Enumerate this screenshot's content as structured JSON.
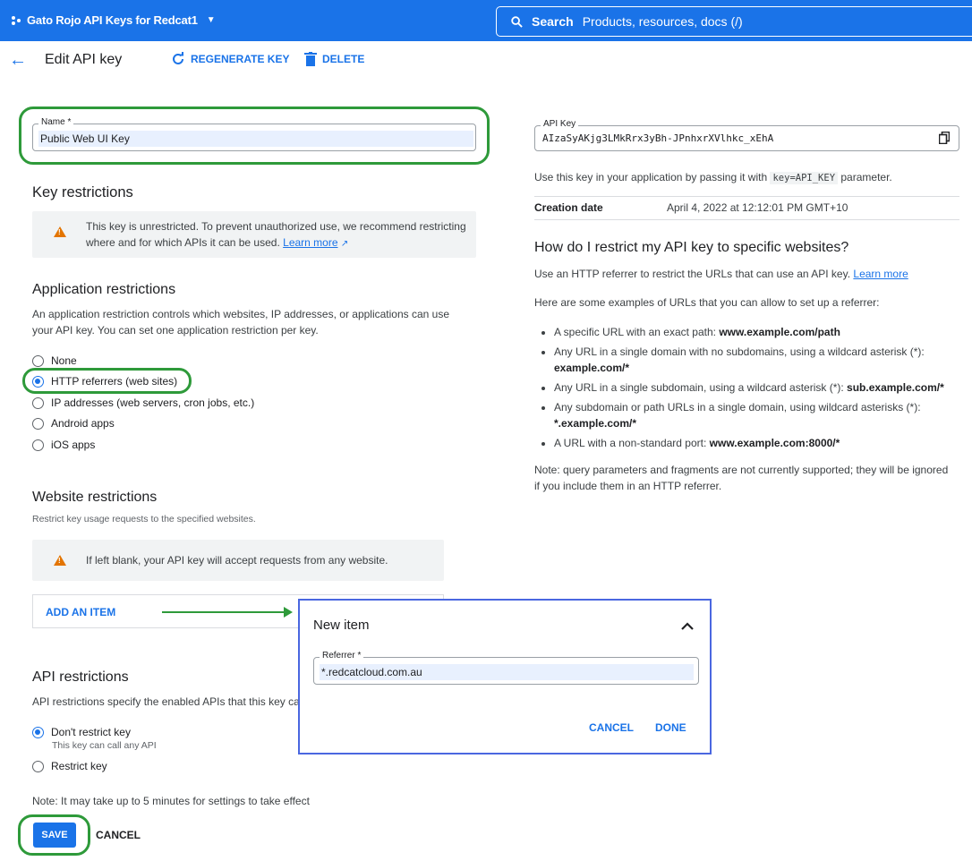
{
  "topbar": {
    "project_name": "Gato Rojo API Keys for Redcat1",
    "search_label": "Search",
    "search_placeholder": "Products, resources, docs (/)"
  },
  "actionbar": {
    "title": "Edit API key",
    "regenerate": "REGENERATE KEY",
    "delete": "DELETE"
  },
  "name_field": {
    "label": "Name *",
    "value": "Public Web UI Key"
  },
  "key_restrictions": {
    "heading": "Key restrictions",
    "warning": "This key is unrestricted. To prevent unauthorized use, we recommend restricting where and for which APIs it can be used.",
    "learn_more": "Learn more"
  },
  "app_restrictions": {
    "heading": "Application restrictions",
    "description": "An application restriction controls which websites, IP addresses, or applications can use your API key. You can set one application restriction per key.",
    "options": [
      "None",
      "HTTP referrers (web sites)",
      "IP addresses (web servers, cron jobs, etc.)",
      "Android apps",
      "iOS apps"
    ],
    "selected": "HTTP referrers (web sites)"
  },
  "website_restrictions": {
    "heading": "Website restrictions",
    "description": "Restrict key usage requests to the specified websites.",
    "warning": "If left blank, your API key will accept requests from any website.",
    "add_item": "ADD AN ITEM"
  },
  "new_item": {
    "title": "New item",
    "referrer_label": "Referrer *",
    "referrer_value": "*.redcatcloud.com.au",
    "cancel": "CANCEL",
    "done": "DONE"
  },
  "api_restrictions": {
    "heading": "API restrictions",
    "description": "API restrictions specify the enabled APIs that this key can",
    "option1": "Don't restrict key",
    "option1_sub": "This key can call any API",
    "option2": "Restrict key",
    "note": "Note: It may take up to 5 minutes for settings to take effect"
  },
  "footer": {
    "save": "SAVE",
    "cancel": "CANCEL"
  },
  "api_key": {
    "label": "API Key",
    "value": "AIzaSyAKjg3LMkRrx3yBh-JPnhxrXVlhkc_xEhA",
    "usage_prefix": "Use this key in your application by passing it with",
    "usage_code": "key=API_KEY",
    "usage_suffix": "parameter.",
    "creation_label": "Creation date",
    "creation_value": "April 4, 2022 at 12:12:01 PM GMT+10"
  },
  "help": {
    "heading": "How do I restrict my API key to specific websites?",
    "intro": "Use an HTTP referrer to restrict the URLs that can use an API key.",
    "learn_more": "Learn more",
    "examples_intro": "Here are some examples of URLs that you can allow to set up a referrer:",
    "bullets": [
      {
        "text": "A specific URL with an exact path:",
        "example": "www.example.com/path"
      },
      {
        "text": "Any URL in a single domain with no subdomains, using a wildcard asterisk (*):",
        "example": "example.com/*"
      },
      {
        "text": "Any URL in a single subdomain, using a wildcard asterisk (*):",
        "example": "sub.example.com/*"
      },
      {
        "text": "Any subdomain or path URLs in a single domain, using wildcard asterisks (*):",
        "example": "*.example.com/*"
      },
      {
        "text": "A URL with a non-standard port:",
        "example": "www.example.com:8000/*"
      }
    ],
    "note": "Note: query parameters and fragments are not currently supported; they will be ignored if you include them in an HTTP referrer."
  },
  "colors": {
    "primary": "#1a73e8",
    "highlight_ring": "#2e9a3a",
    "popup_border": "#4a67e0",
    "warning": "#e37400"
  },
  "icons": {
    "project": "project-dots-icon",
    "search": "search-icon",
    "back": "arrow-back-icon",
    "refresh": "refresh-icon",
    "delete": "trash-icon",
    "warning": "warning-icon",
    "external": "external-link-icon",
    "copy": "copy-icon",
    "collapse": "chevron-up-icon"
  }
}
